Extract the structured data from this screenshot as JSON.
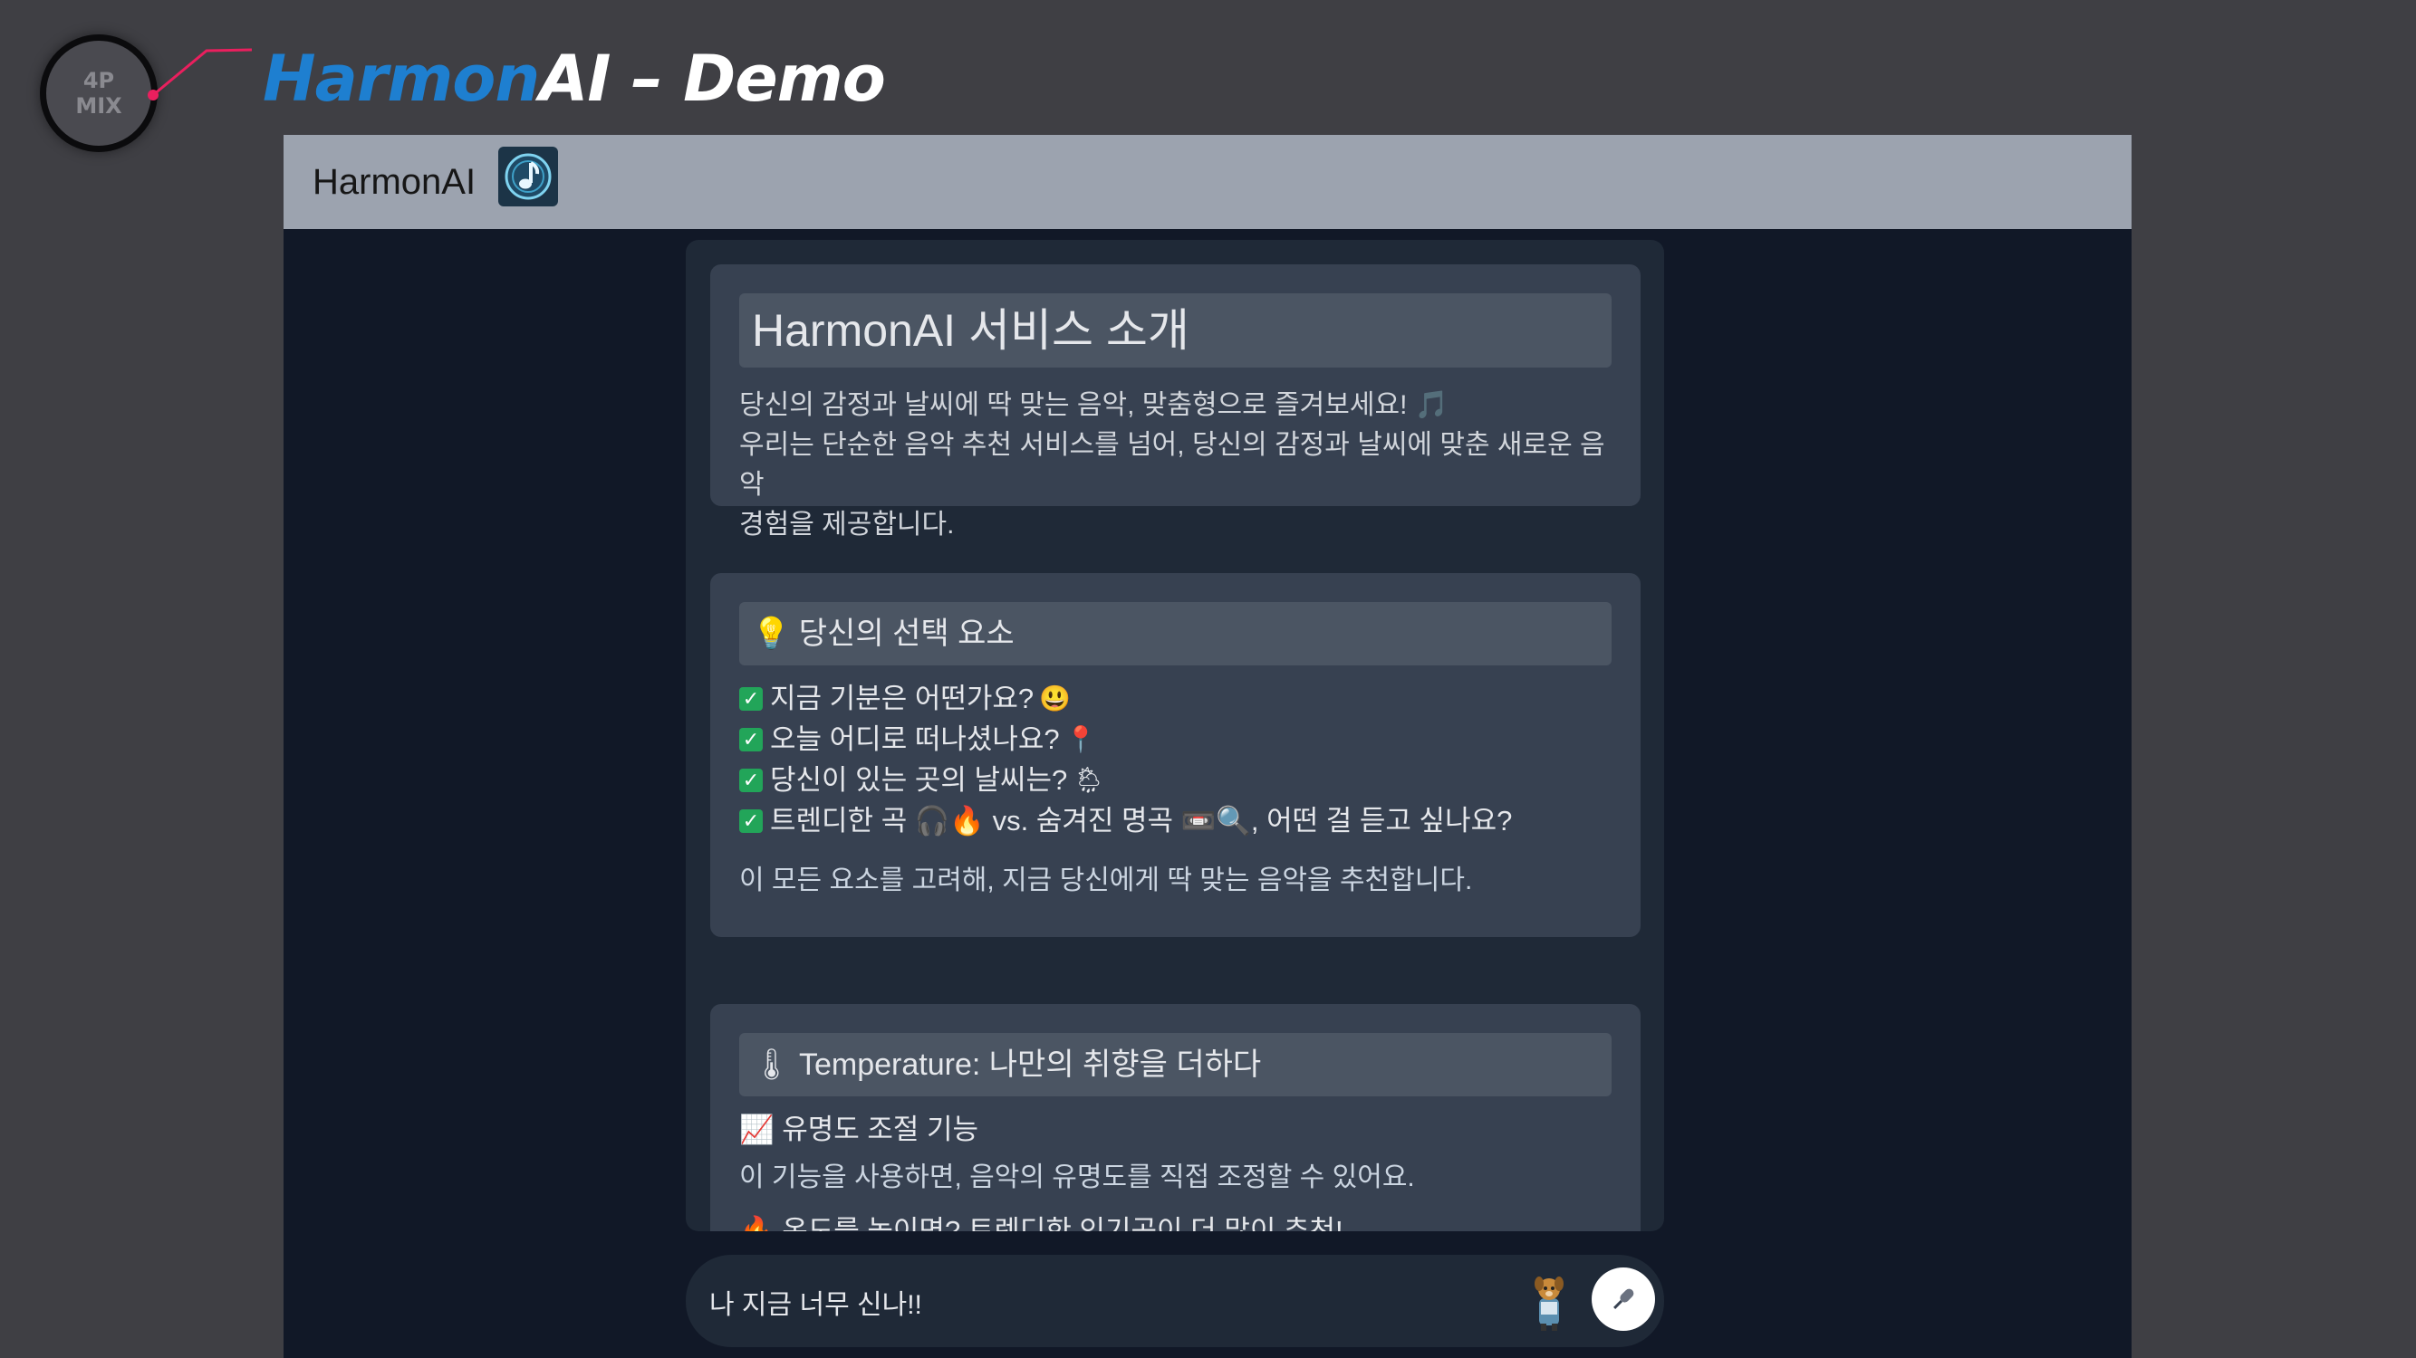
{
  "slide": {
    "logo_line1": "4P",
    "logo_line2": "MIX",
    "title_blue": "Harmon",
    "title_rest": "AI – Demo"
  },
  "navbar": {
    "brand": "HarmonAI",
    "brand_icon": "music-note-icon"
  },
  "intro_card": {
    "heading": "HarmonAI 서비스 소개",
    "line1": "당신의 감정과 날씨에 딱 맞는 음악, 맞춤형으로 즐겨보세요! 🎵",
    "line2": "우리는 단순한 음악 추천 서비스를 넘어, 당신의 감정과 날씨에 맞춘 새로운 음악",
    "line3": "경험을 제공합니다."
  },
  "choice_card": {
    "heading": "💡 당신의 선택 요소",
    "items": [
      {
        "text": "지금 기분은 어떤가요?",
        "emoji": "😃"
      },
      {
        "text": "오늘 어디로 떠나셨나요?",
        "emoji": "📍"
      },
      {
        "text": "당신이 있는 곳의 날씨는?",
        "emoji": "🌦"
      },
      {
        "text": "트렌디한 곡 🎧🔥 vs. 숨겨진 명곡 📼🔍, 어떤 걸 듣고 싶나요?",
        "emoji": ""
      }
    ],
    "summary": "이 모든 요소를 고려해, 지금 당신에게 딱 맞는 음악을 추천합니다."
  },
  "temperature_card": {
    "heading": "🌡 Temperature: 나만의 취향을 더하다",
    "feature_title": "📈 유명도 조절 기능",
    "feature_desc": "이 기능을 사용하면, 음악의 유명도를 직접 조정할 수 있어요.",
    "hot_line": "🔥 온도를 높이면? 트렌디한 인기곡이 더 많이 추천!"
  },
  "chat": {
    "input_value": "나 지금 너무 신나!!",
    "mic_icon": "microphone-icon",
    "mascot_icon": "dog-mascot-icon"
  },
  "colors": {
    "title_blue": "#1e7fd0",
    "navbar": "#9ca3af",
    "page_bg": "#111827",
    "panel": "#1f2937",
    "card": "#374151",
    "card_head": "#4b5563",
    "check_green": "#22a559",
    "pointer_pink": "#ea1f5e"
  }
}
